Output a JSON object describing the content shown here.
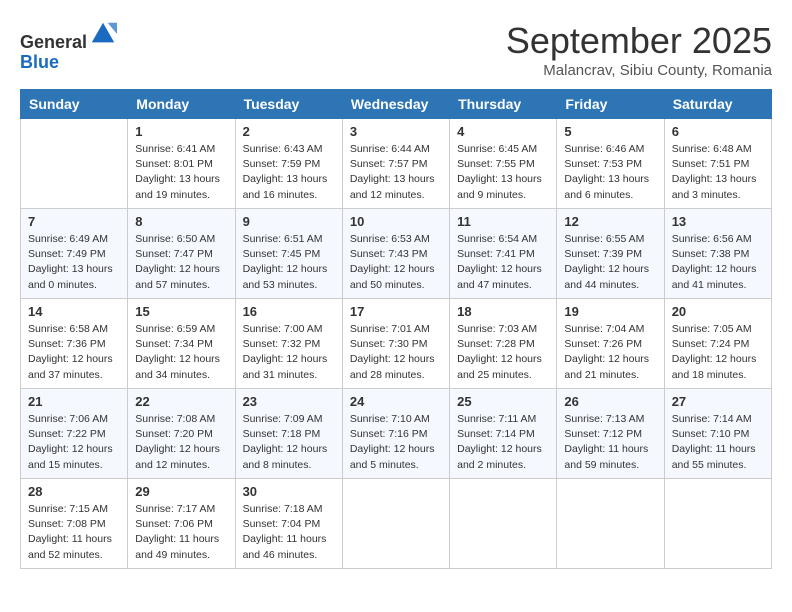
{
  "header": {
    "logo_line1": "General",
    "logo_line2": "Blue",
    "month_title": "September 2025",
    "location": "Malancrav, Sibiu County, Romania"
  },
  "days_of_week": [
    "Sunday",
    "Monday",
    "Tuesday",
    "Wednesday",
    "Thursday",
    "Friday",
    "Saturday"
  ],
  "weeks": [
    [
      {
        "day": "",
        "info": ""
      },
      {
        "day": "1",
        "info": "Sunrise: 6:41 AM\nSunset: 8:01 PM\nDaylight: 13 hours\nand 19 minutes."
      },
      {
        "day": "2",
        "info": "Sunrise: 6:43 AM\nSunset: 7:59 PM\nDaylight: 13 hours\nand 16 minutes."
      },
      {
        "day": "3",
        "info": "Sunrise: 6:44 AM\nSunset: 7:57 PM\nDaylight: 13 hours\nand 12 minutes."
      },
      {
        "day": "4",
        "info": "Sunrise: 6:45 AM\nSunset: 7:55 PM\nDaylight: 13 hours\nand 9 minutes."
      },
      {
        "day": "5",
        "info": "Sunrise: 6:46 AM\nSunset: 7:53 PM\nDaylight: 13 hours\nand 6 minutes."
      },
      {
        "day": "6",
        "info": "Sunrise: 6:48 AM\nSunset: 7:51 PM\nDaylight: 13 hours\nand 3 minutes."
      }
    ],
    [
      {
        "day": "7",
        "info": "Sunrise: 6:49 AM\nSunset: 7:49 PM\nDaylight: 13 hours\nand 0 minutes."
      },
      {
        "day": "8",
        "info": "Sunrise: 6:50 AM\nSunset: 7:47 PM\nDaylight: 12 hours\nand 57 minutes."
      },
      {
        "day": "9",
        "info": "Sunrise: 6:51 AM\nSunset: 7:45 PM\nDaylight: 12 hours\nand 53 minutes."
      },
      {
        "day": "10",
        "info": "Sunrise: 6:53 AM\nSunset: 7:43 PM\nDaylight: 12 hours\nand 50 minutes."
      },
      {
        "day": "11",
        "info": "Sunrise: 6:54 AM\nSunset: 7:41 PM\nDaylight: 12 hours\nand 47 minutes."
      },
      {
        "day": "12",
        "info": "Sunrise: 6:55 AM\nSunset: 7:39 PM\nDaylight: 12 hours\nand 44 minutes."
      },
      {
        "day": "13",
        "info": "Sunrise: 6:56 AM\nSunset: 7:38 PM\nDaylight: 12 hours\nand 41 minutes."
      }
    ],
    [
      {
        "day": "14",
        "info": "Sunrise: 6:58 AM\nSunset: 7:36 PM\nDaylight: 12 hours\nand 37 minutes."
      },
      {
        "day": "15",
        "info": "Sunrise: 6:59 AM\nSunset: 7:34 PM\nDaylight: 12 hours\nand 34 minutes."
      },
      {
        "day": "16",
        "info": "Sunrise: 7:00 AM\nSunset: 7:32 PM\nDaylight: 12 hours\nand 31 minutes."
      },
      {
        "day": "17",
        "info": "Sunrise: 7:01 AM\nSunset: 7:30 PM\nDaylight: 12 hours\nand 28 minutes."
      },
      {
        "day": "18",
        "info": "Sunrise: 7:03 AM\nSunset: 7:28 PM\nDaylight: 12 hours\nand 25 minutes."
      },
      {
        "day": "19",
        "info": "Sunrise: 7:04 AM\nSunset: 7:26 PM\nDaylight: 12 hours\nand 21 minutes."
      },
      {
        "day": "20",
        "info": "Sunrise: 7:05 AM\nSunset: 7:24 PM\nDaylight: 12 hours\nand 18 minutes."
      }
    ],
    [
      {
        "day": "21",
        "info": "Sunrise: 7:06 AM\nSunset: 7:22 PM\nDaylight: 12 hours\nand 15 minutes."
      },
      {
        "day": "22",
        "info": "Sunrise: 7:08 AM\nSunset: 7:20 PM\nDaylight: 12 hours\nand 12 minutes."
      },
      {
        "day": "23",
        "info": "Sunrise: 7:09 AM\nSunset: 7:18 PM\nDaylight: 12 hours\nand 8 minutes."
      },
      {
        "day": "24",
        "info": "Sunrise: 7:10 AM\nSunset: 7:16 PM\nDaylight: 12 hours\nand 5 minutes."
      },
      {
        "day": "25",
        "info": "Sunrise: 7:11 AM\nSunset: 7:14 PM\nDaylight: 12 hours\nand 2 minutes."
      },
      {
        "day": "26",
        "info": "Sunrise: 7:13 AM\nSunset: 7:12 PM\nDaylight: 11 hours\nand 59 minutes."
      },
      {
        "day": "27",
        "info": "Sunrise: 7:14 AM\nSunset: 7:10 PM\nDaylight: 11 hours\nand 55 minutes."
      }
    ],
    [
      {
        "day": "28",
        "info": "Sunrise: 7:15 AM\nSunset: 7:08 PM\nDaylight: 11 hours\nand 52 minutes."
      },
      {
        "day": "29",
        "info": "Sunrise: 7:17 AM\nSunset: 7:06 PM\nDaylight: 11 hours\nand 49 minutes."
      },
      {
        "day": "30",
        "info": "Sunrise: 7:18 AM\nSunset: 7:04 PM\nDaylight: 11 hours\nand 46 minutes."
      },
      {
        "day": "",
        "info": ""
      },
      {
        "day": "",
        "info": ""
      },
      {
        "day": "",
        "info": ""
      },
      {
        "day": "",
        "info": ""
      }
    ]
  ]
}
